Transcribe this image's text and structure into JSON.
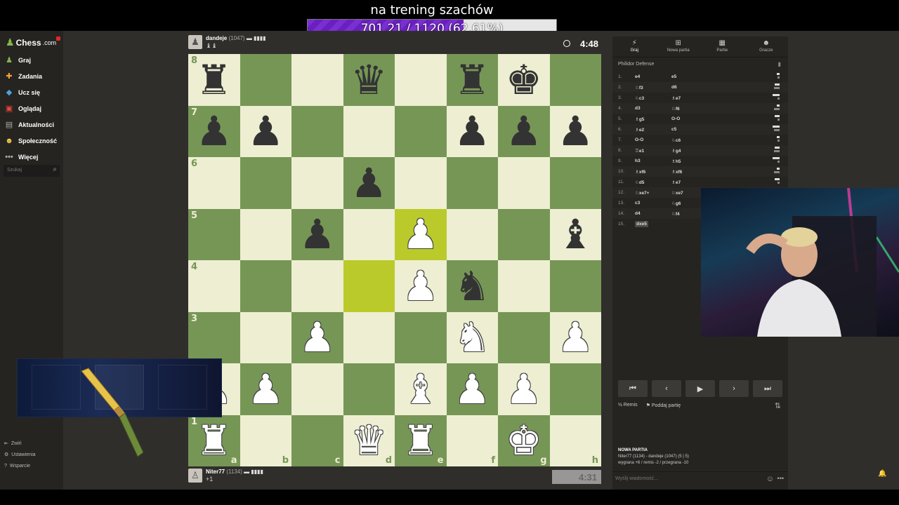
{
  "overlay": {
    "title": "na trening szachów",
    "goal_text": "701.21 / 1120 (62.61%)",
    "goal_fraction": 0.6261
  },
  "sidebar": {
    "logo_text": "Chess",
    "logo_domain": ".com",
    "items": [
      {
        "label": "Graj",
        "icon": "chess-piece-icon"
      },
      {
        "label": "Zadania",
        "icon": "puzzle-icon"
      },
      {
        "label": "Ucz się",
        "icon": "graduation-cap-icon"
      },
      {
        "label": "Oglądaj",
        "icon": "tv-icon"
      },
      {
        "label": "Aktualności",
        "icon": "news-icon"
      },
      {
        "label": "Społeczność",
        "icon": "people-icon"
      },
      {
        "label": "Więcej",
        "icon": "more-dots-icon"
      }
    ],
    "search_placeholder": "Szukaj",
    "bottom": [
      "Zwiń",
      "Ustawienia",
      "Wsparcie"
    ]
  },
  "top_player": {
    "name": "dandeje",
    "rating": "(1047)",
    "captured": "♝♝"
  },
  "bottom_player": {
    "name": "Niter77",
    "rating": "(1134)",
    "material": "+1"
  },
  "clocks": {
    "top": "4:48",
    "bottom": "4:31"
  },
  "board": {
    "colors": {
      "light": "#eeeed2",
      "dark": "#769656",
      "highlight_light": "#f6f669",
      "highlight_dark": "#baca2b"
    },
    "ranks": [
      "8",
      "7",
      "6",
      "5",
      "4",
      "3",
      "2",
      "1"
    ],
    "files": [
      "a",
      "b",
      "c",
      "d",
      "e",
      "f",
      "g",
      "h"
    ],
    "highlighted": [
      "d4",
      "e5"
    ],
    "pieces": [
      [
        "♜",
        "",
        "",
        "♛",
        "",
        "♜",
        "♚",
        ""
      ],
      [
        "♟",
        "♟",
        "",
        "",
        "",
        "♟",
        "♟",
        "♟"
      ],
      [
        "",
        "",
        "",
        "♟",
        "",
        "",
        "",
        ""
      ],
      [
        "",
        "",
        "♟",
        "",
        "♙",
        "",
        "",
        "♝"
      ],
      [
        "",
        "",
        "",
        "",
        "♙",
        "♞",
        "",
        ""
      ],
      [
        "",
        "",
        "♙",
        "",
        "",
        "♘",
        "",
        "♙"
      ],
      [
        "♙",
        "♙",
        "",
        "",
        "♗",
        "♙",
        "♙",
        ""
      ],
      [
        "♖",
        "",
        "",
        "♕",
        "♖",
        "",
        "♔",
        ""
      ]
    ]
  },
  "panel": {
    "tabs": [
      {
        "label": "Graj",
        "icon": "lightning-icon"
      },
      {
        "label": "Nowa partia",
        "icon": "plus-icon"
      },
      {
        "label": "Partie",
        "icon": "grid-icon"
      },
      {
        "label": "Gracze",
        "icon": "people-icon"
      }
    ],
    "opening": "Philidor Defense",
    "moves": [
      {
        "n": "1.",
        "w": "e4",
        "b": "e5"
      },
      {
        "n": "2.",
        "w": "♘f3",
        "b": "d6"
      },
      {
        "n": "3.",
        "w": "♘c3",
        "b": "♗e7"
      },
      {
        "n": "4.",
        "w": "d3",
        "b": "♘f6"
      },
      {
        "n": "5.",
        "w": "♗g5",
        "b": "O-O"
      },
      {
        "n": "6.",
        "w": "♗e2",
        "b": "c5"
      },
      {
        "n": "7.",
        "w": "O-O",
        "b": "♘c6"
      },
      {
        "n": "8.",
        "w": "♖e1",
        "b": "♗g4"
      },
      {
        "n": "9.",
        "w": "h3",
        "b": "♗h5"
      },
      {
        "n": "10.",
        "w": "♗xf6",
        "b": "♗xf6"
      },
      {
        "n": "11.",
        "w": "♘d5",
        "b": "♗e7"
      },
      {
        "n": "12.",
        "w": "♘xe7+",
        "b": "♘xe7"
      },
      {
        "n": "13.",
        "w": "c3",
        "b": "♘g6"
      },
      {
        "n": "14.",
        "w": "d4",
        "b": "♘f4"
      },
      {
        "n": "15.",
        "w": "dxe5",
        "b": ""
      }
    ],
    "actions": {
      "draw": "Remis",
      "resign": "Poddaj partię"
    },
    "new_game_heading": "NOWA PARTIA",
    "new_game_players": "Niter77 (1134) - dandeje (1047) (5 | 5)",
    "new_game_stakes": "wygrana +6 / remis -2 / przegrana -10",
    "chat_placeholder": "Wyślij wiadomość..."
  }
}
